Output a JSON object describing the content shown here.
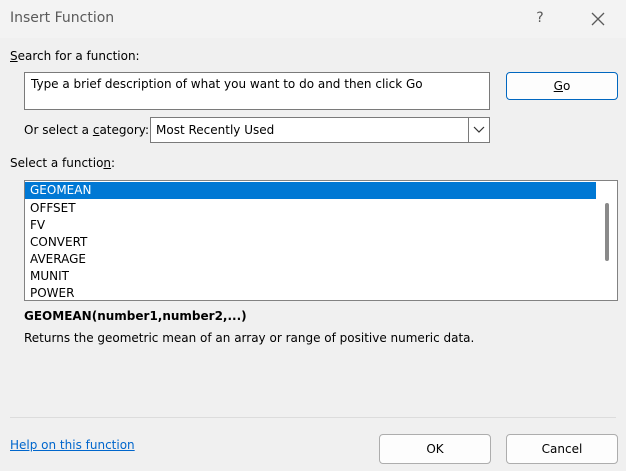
{
  "window": {
    "title": "Insert Function",
    "help": "?"
  },
  "search": {
    "label": "Search for a function:",
    "label_access": "S",
    "label_rest": "earch for a function:",
    "value": "Type a brief description of what you want to do and then click Go",
    "go_access": "G",
    "go_rest": "o"
  },
  "category": {
    "label_pre": "Or select a ",
    "label_access": "c",
    "label_post": "ategory:",
    "selected": "Most Recently Used"
  },
  "functions": {
    "label_pre": "Select a functio",
    "label_access": "n",
    "label_post": ":",
    "items": [
      "GEOMEAN",
      "OFFSET",
      "FV",
      "CONVERT",
      "AVERAGE",
      "MUNIT",
      "POWER"
    ],
    "selected_index": 0
  },
  "details": {
    "signature": "GEOMEAN(number1,number2,...)",
    "description": "Returns the geometric mean of an array or range of positive numeric data."
  },
  "footer": {
    "help_link": "Help on this function",
    "ok": "OK",
    "cancel": "Cancel"
  },
  "colors": {
    "selection": "#0078d4",
    "link": "#0066cc",
    "go_border": "#0067c0"
  },
  "icons": {
    "close": "close-icon",
    "dropdown": "chevron-down-icon"
  }
}
